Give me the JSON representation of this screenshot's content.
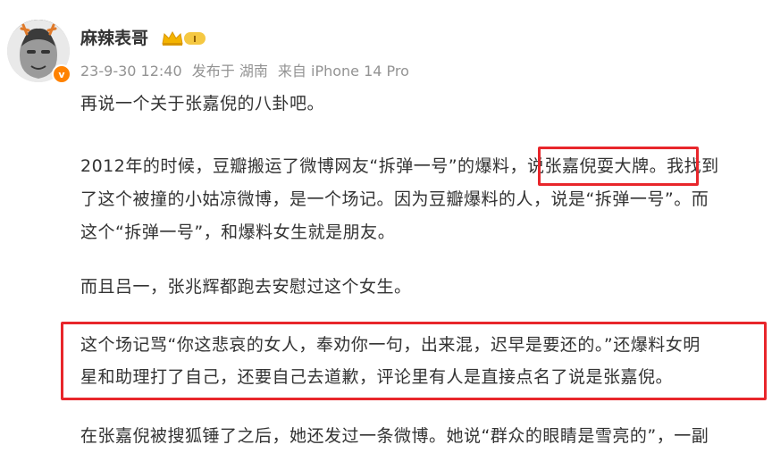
{
  "post": {
    "author": "麻辣表哥",
    "level_badge": "I",
    "verified_mark": "v",
    "date": "23-9-30 12:40",
    "published_at": "发布于 湖南",
    "source": "来自 iPhone 14 Pro",
    "paragraphs": {
      "p1": "再说一个关于张嘉倪的八卦吧。",
      "p2_l1a": "2012年的时候，豆瓣搬运了微博网友“拆弹一号”的爆料，",
      "p2_l1b": "说张嘉倪耍大牌",
      "p2_l1c": "。我找到",
      "p2_l2": "了这个被撞的小姑凉微博，是一个场记。因为豆瓣爆料的人，说是“拆弹一号”。而",
      "p2_l3": "这个“拆弹一号”，和爆料女生就是朋友。",
      "p3": "而且吕一，张兆辉都跑去安慰过这个女生。",
      "p4_l1": "这个场记骂“你这悲哀的女人，奉劝你一句，出来混，迟早是要还的。”还爆料女明",
      "p4_l2": "星和助理打了自己，还要自己去道歉，评论里有人是直接点名了说是张嘉倪。",
      "p5": "在张嘉倪被搜狐锤了之后，她还发过一条微博。她说“群众的眼睛是雪亮的”，一副"
    }
  },
  "colors": {
    "highlight_box": "#e8262b",
    "meta_text": "#939393",
    "body_text": "#333333",
    "badge": "#ff8200"
  },
  "icons": {
    "avatar": "avatar",
    "verified": "verified-badge-icon",
    "crown": "crown-level-icon"
  }
}
